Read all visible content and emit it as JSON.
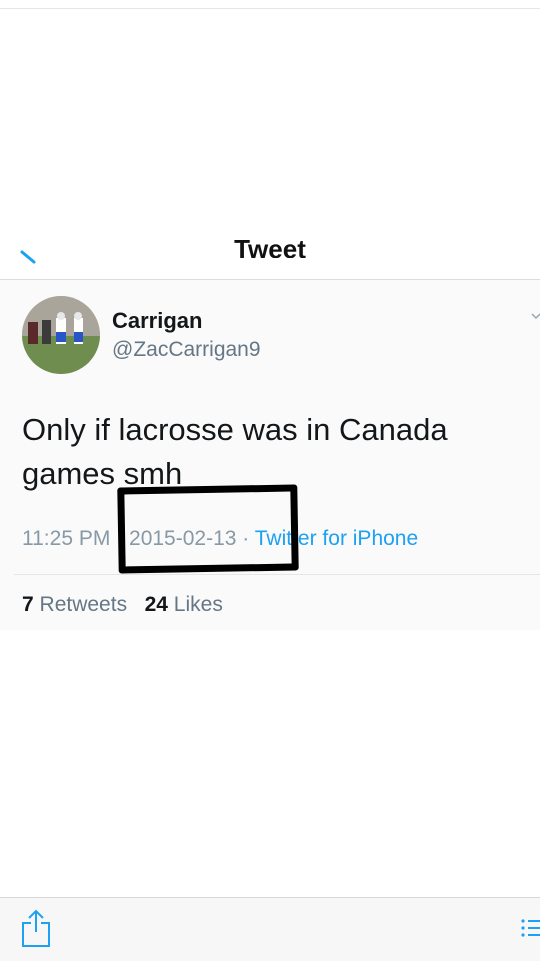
{
  "nav": {
    "title": "Tweet"
  },
  "tweet": {
    "name": "Carrigan",
    "handle": "@ZacCarrigan9",
    "text": "Only if lacrosse was in Canada games smh",
    "time": "11:25 PM",
    "date": "2015-02-13",
    "separator": "·",
    "source": "Twitter for iPhone",
    "retweets": "7",
    "retweets_label": "Retweets",
    "likes": "24",
    "likes_label": "Likes"
  },
  "colors": {
    "link": "#1da1f2",
    "secondary": "#657786",
    "redaction": "#000000"
  }
}
